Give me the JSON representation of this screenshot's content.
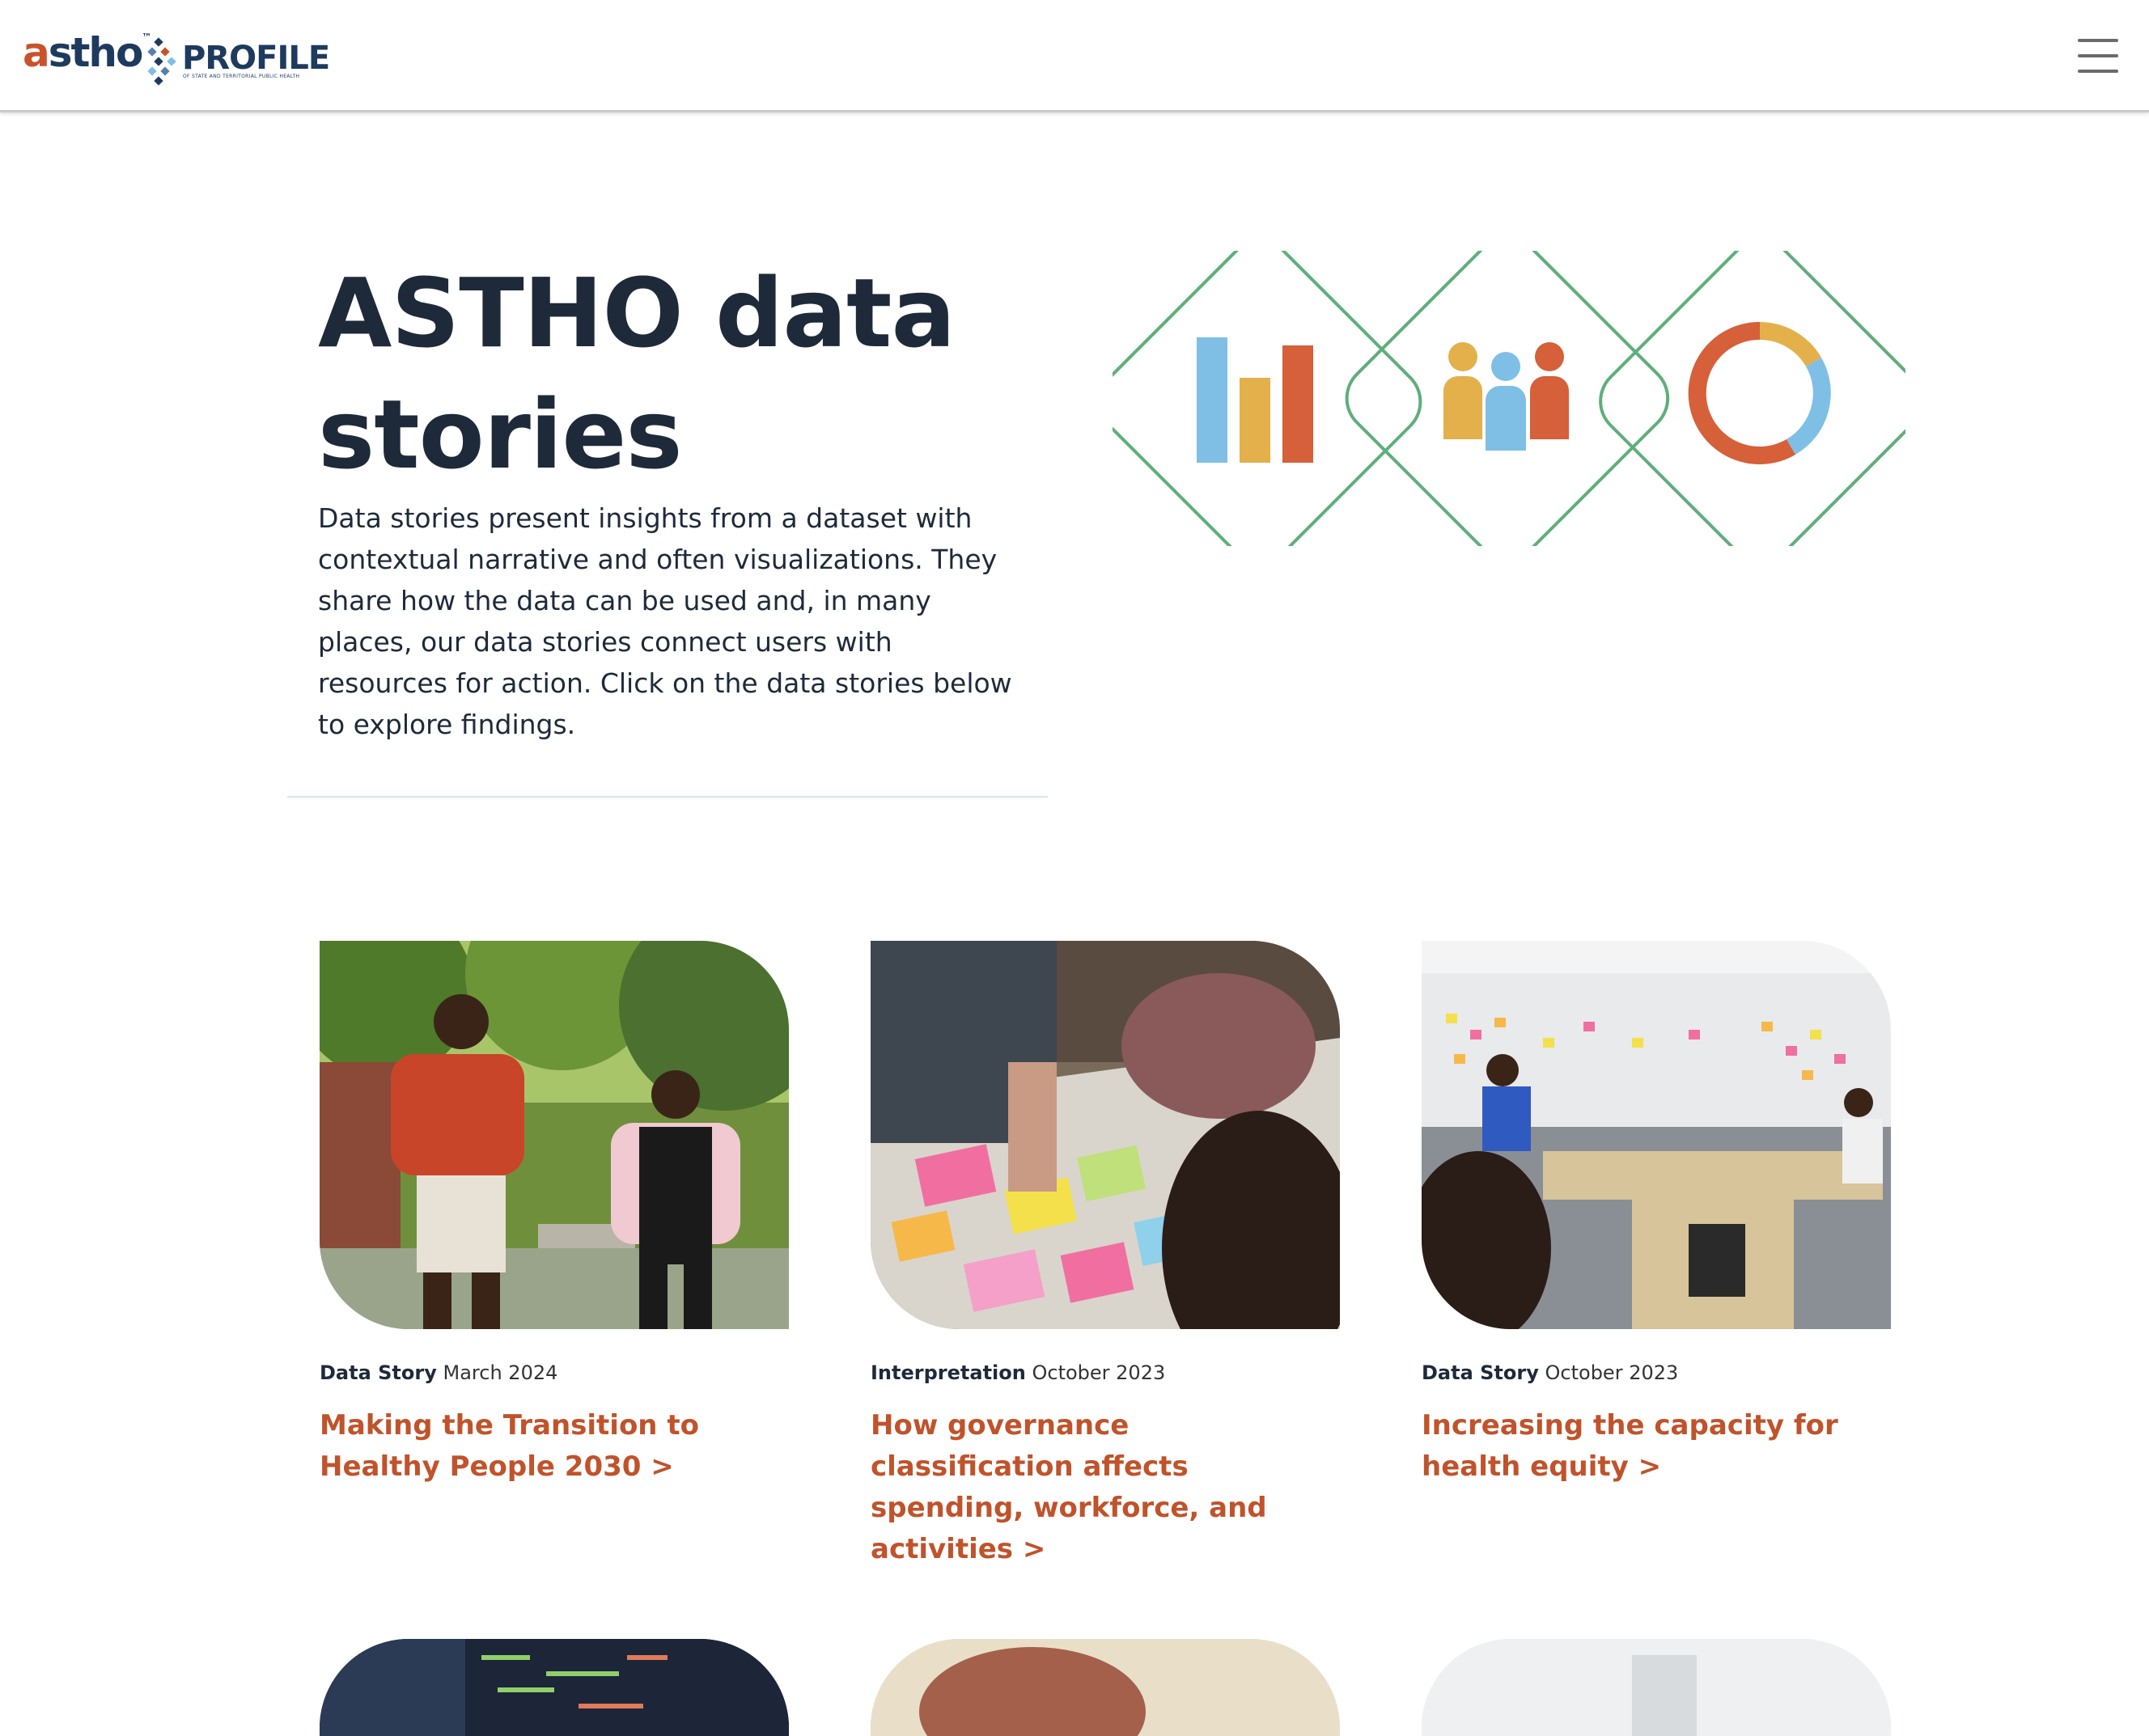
{
  "header": {
    "logo_astho": {
      "first": "a",
      "rest": "stho",
      "tm": "™"
    },
    "logo_profile": "PROFILE",
    "logo_profile_sub": "OF STATE AND TERRITORIAL PUBLIC HEALTH",
    "menu_icon": "hamburger-icon"
  },
  "hero": {
    "title": "ASTHO data stories",
    "description": "Data stories present insights from a dataset with contextual narrative and often visualizations. They share how the data can be used and, in many places, our data stories connect users with resources for action. Click on the data stories below to explore findings.",
    "icons": [
      "bar-chart-icon",
      "people-icon",
      "donut-chart-icon"
    ]
  },
  "colors": {
    "accent": "#c0532b",
    "navy": "#1e2a3a",
    "green_outline": "#5fae7b",
    "blue": "#7fbfe6",
    "gold": "#e3b04b",
    "orange": "#d5603a"
  },
  "cards": [
    {
      "type": "Data Story",
      "date": "March 2024",
      "title": "Making the Transition to Healthy People 2030 >",
      "image": "two-people-jogging-photo"
    },
    {
      "type": "Interpretation",
      "date": "October 2023",
      "title": "How governance classification affects spending, workforce, and activities >",
      "image": "sticky-notes-planning-photo"
    },
    {
      "type": "Data Story",
      "date": "October 2023",
      "title": "Increasing the capacity for health equity >",
      "image": "meeting-room-photo"
    }
  ]
}
